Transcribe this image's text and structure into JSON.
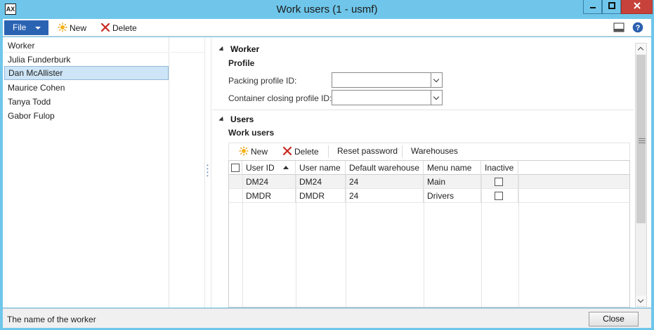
{
  "window": {
    "title": "Work users (1 - usmf)",
    "icons": [
      "app-icon",
      "minimize-icon",
      "maximize-icon",
      "close-icon"
    ]
  },
  "toolbar": {
    "file_label": "File",
    "new_label": "New",
    "delete_label": "Delete",
    "icons": [
      "new-sun-icon",
      "delete-x-icon",
      "view-icon",
      "help-icon"
    ]
  },
  "list": {
    "header": "Worker",
    "items": [
      {
        "label": "Julia Funderburk",
        "selected": false
      },
      {
        "label": "Dan McAllister",
        "selected": true
      },
      {
        "label": "Maurice Cohen",
        "selected": false
      },
      {
        "label": "Tanya Todd",
        "selected": false
      },
      {
        "label": "Gabor Fulop",
        "selected": false
      }
    ]
  },
  "worker_section": {
    "title": "Worker",
    "subtitle": "Profile",
    "packing_label": "Packing profile ID:",
    "packing_value": "",
    "container_label": "Container closing profile ID:",
    "container_value": ""
  },
  "users_section": {
    "title": "Users",
    "subtitle": "Work users",
    "toolbar": {
      "new_label": "New",
      "delete_label": "Delete",
      "reset_label": "Reset password",
      "warehouses_label": "Warehouses"
    },
    "columns": [
      "User ID",
      "User name",
      "Default warehouse",
      "Menu name",
      "Inactive"
    ],
    "rows": [
      {
        "user_id": "DM24",
        "user_name": "DM24",
        "warehouse": "24",
        "menu": "Main",
        "inactive": false
      },
      {
        "user_id": "DMDR",
        "user_name": "DMDR",
        "warehouse": "24",
        "menu": "Drivers",
        "inactive": false
      }
    ]
  },
  "status": {
    "text": "The name of the worker",
    "close_label": "Close"
  }
}
